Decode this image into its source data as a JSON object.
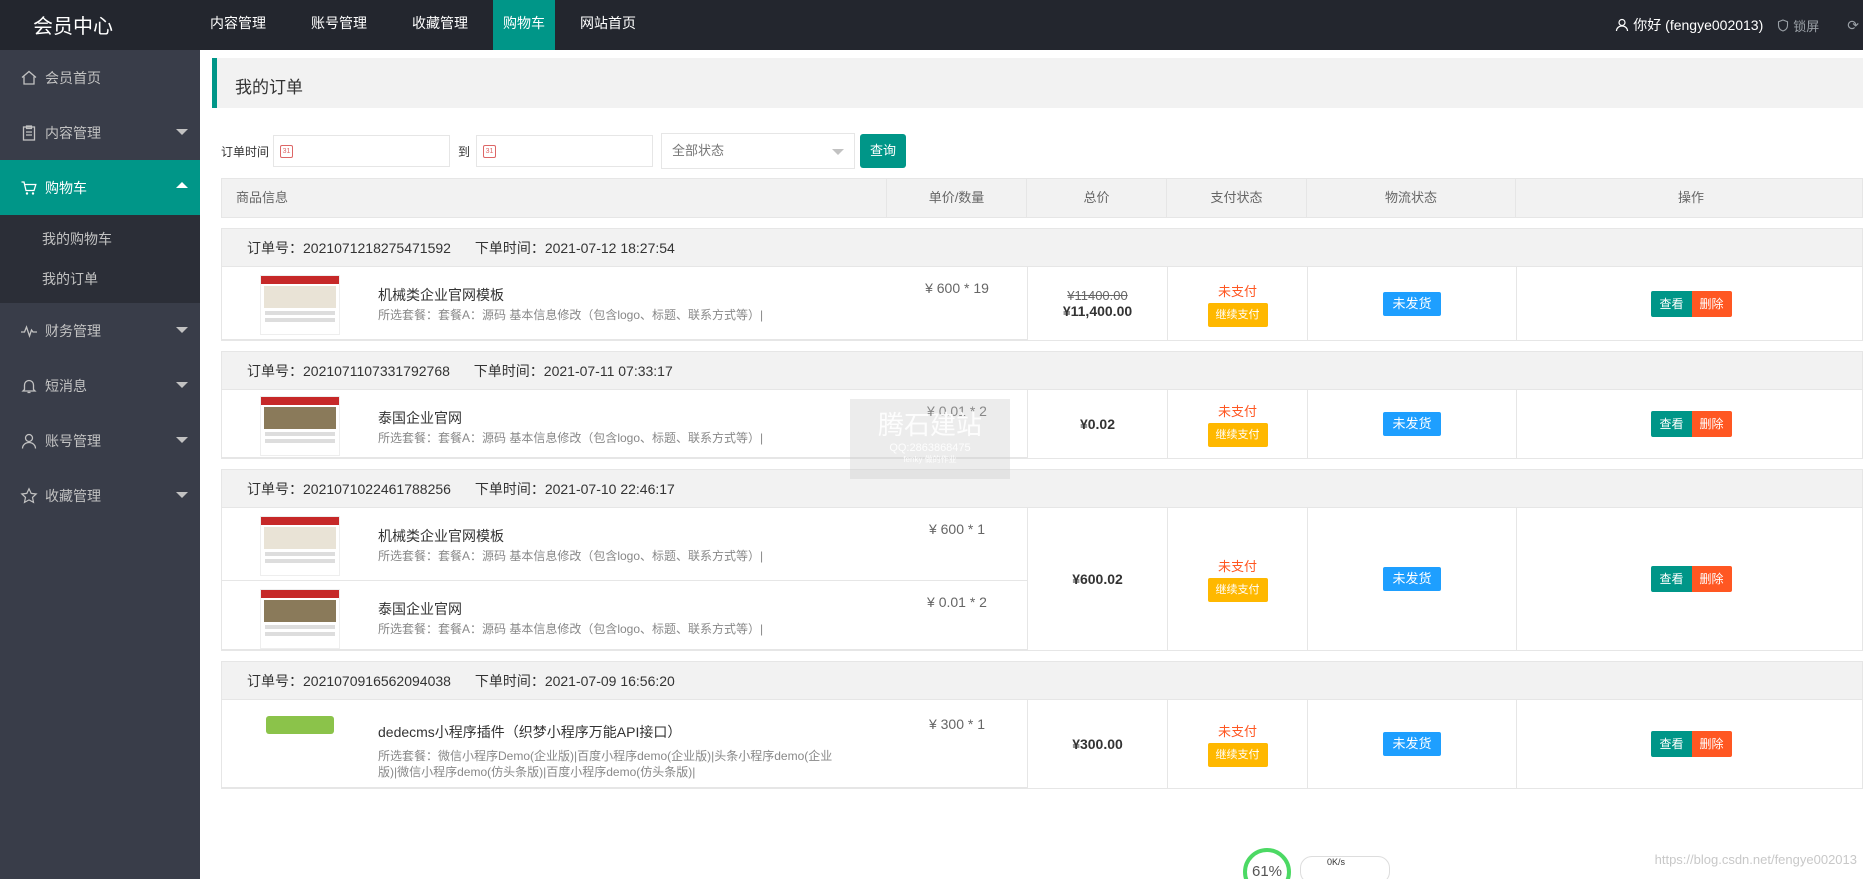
{
  "brand": "会员中心",
  "topnav": [
    "内容管理",
    "账号管理",
    "收藏管理",
    "购物车",
    "网站首页"
  ],
  "topnav_active": 3,
  "user": {
    "greeting": "你好 (fengye002013)",
    "lock": "锁屏"
  },
  "sidebar": {
    "items": [
      {
        "label": "会员首页",
        "icon": "home-icon"
      },
      {
        "label": "内容管理",
        "icon": "clipboard-icon"
      },
      {
        "label": "购物车",
        "icon": "cart-icon"
      },
      {
        "label": "财务管理",
        "icon": "pulse-icon"
      },
      {
        "label": "短消息",
        "icon": "bell-icon"
      },
      {
        "label": "账号管理",
        "icon": "user-icon"
      },
      {
        "label": "收藏管理",
        "icon": "star-icon"
      }
    ],
    "sub_items": [
      "我的购物车",
      "我的订单"
    ]
  },
  "page_title": "我的订单",
  "filter": {
    "time_label": "订单时间",
    "to_label": "到",
    "status_selected": "全部状态",
    "query_button": "查询"
  },
  "table_headers": [
    "商品信息",
    "单价/数量",
    "总价",
    "支付状态",
    "物流状态",
    "操作"
  ],
  "labels": {
    "order_no": "订单号：",
    "order_time": "下单时间：",
    "unpaid": "未支付",
    "pay_button": "继续支付",
    "ship_status": "未发货",
    "view": "查看",
    "delete": "删除"
  },
  "orders": [
    {
      "no": "20210712182754715 92",
      "no_text": "订单号：2021071218275471592",
      "time_text": "下单时间：2021-07-12 18:27:54",
      "old_total": "¥11400.00",
      "total": "¥11,400.00",
      "products": [
        {
          "name": "机械类企业官网模板",
          "desc": "所选套餐：套餐A：源码 基本信息修改（包含logo、标题、联系方式等）|",
          "unit": "¥ 600 * 19",
          "thumb": "web"
        }
      ]
    },
    {
      "no_text": "订单号：2021071107331792768",
      "time_text": "下单时间：2021-07-11 07:33:17",
      "old_total": "",
      "total": "¥0.02",
      "products": [
        {
          "name": "泰国企业官网",
          "desc": "所选套餐：套餐A：源码 基本信息修改（包含logo、标题、联系方式等）|",
          "unit": "¥ 0.01 * 2",
          "thumb": "land"
        }
      ]
    },
    {
      "no_text": "订单号：2021071022461788256",
      "time_text": "下单时间：2021-07-10 22:46:17",
      "old_total": "",
      "total": "¥600.02",
      "products": [
        {
          "name": "机械类企业官网模板",
          "desc": "所选套餐：套餐A：源码 基本信息修改（包含logo、标题、联系方式等）|",
          "unit": "¥ 600 * 1",
          "thumb": "web"
        },
        {
          "name": "泰国企业官网",
          "desc": "所选套餐：套餐A：源码 基本信息修改（包含logo、标题、联系方式等）|",
          "unit": "¥ 0.01 * 2",
          "thumb": "land"
        }
      ]
    },
    {
      "no_text": "订单号：2021070916562094038",
      "time_text": "下单时间：2021-07-09 16:56:20",
      "old_total": "",
      "total": "¥300.00",
      "products": [
        {
          "name": "dedecms小程序插件（织梦小程序万能API接口）",
          "desc": "所选套餐：微信小程序Demo(企业版)|百度小程序demo(企业版)|头条小程序demo(企业版)|微信小程序demo(仿头条版)|百度小程序demo(仿头条版)|",
          "unit": "¥ 300 * 1",
          "thumb": "plugin"
        }
      ]
    }
  ],
  "watermark": {
    "line1": "腾石建站",
    "line2": "QQ:2863868475",
    "line3": "fenky 做的作业"
  },
  "csdn": "https://blog.csdn.net/fengye002013",
  "widget": {
    "percent": "61%",
    "speed": "0K/s"
  }
}
